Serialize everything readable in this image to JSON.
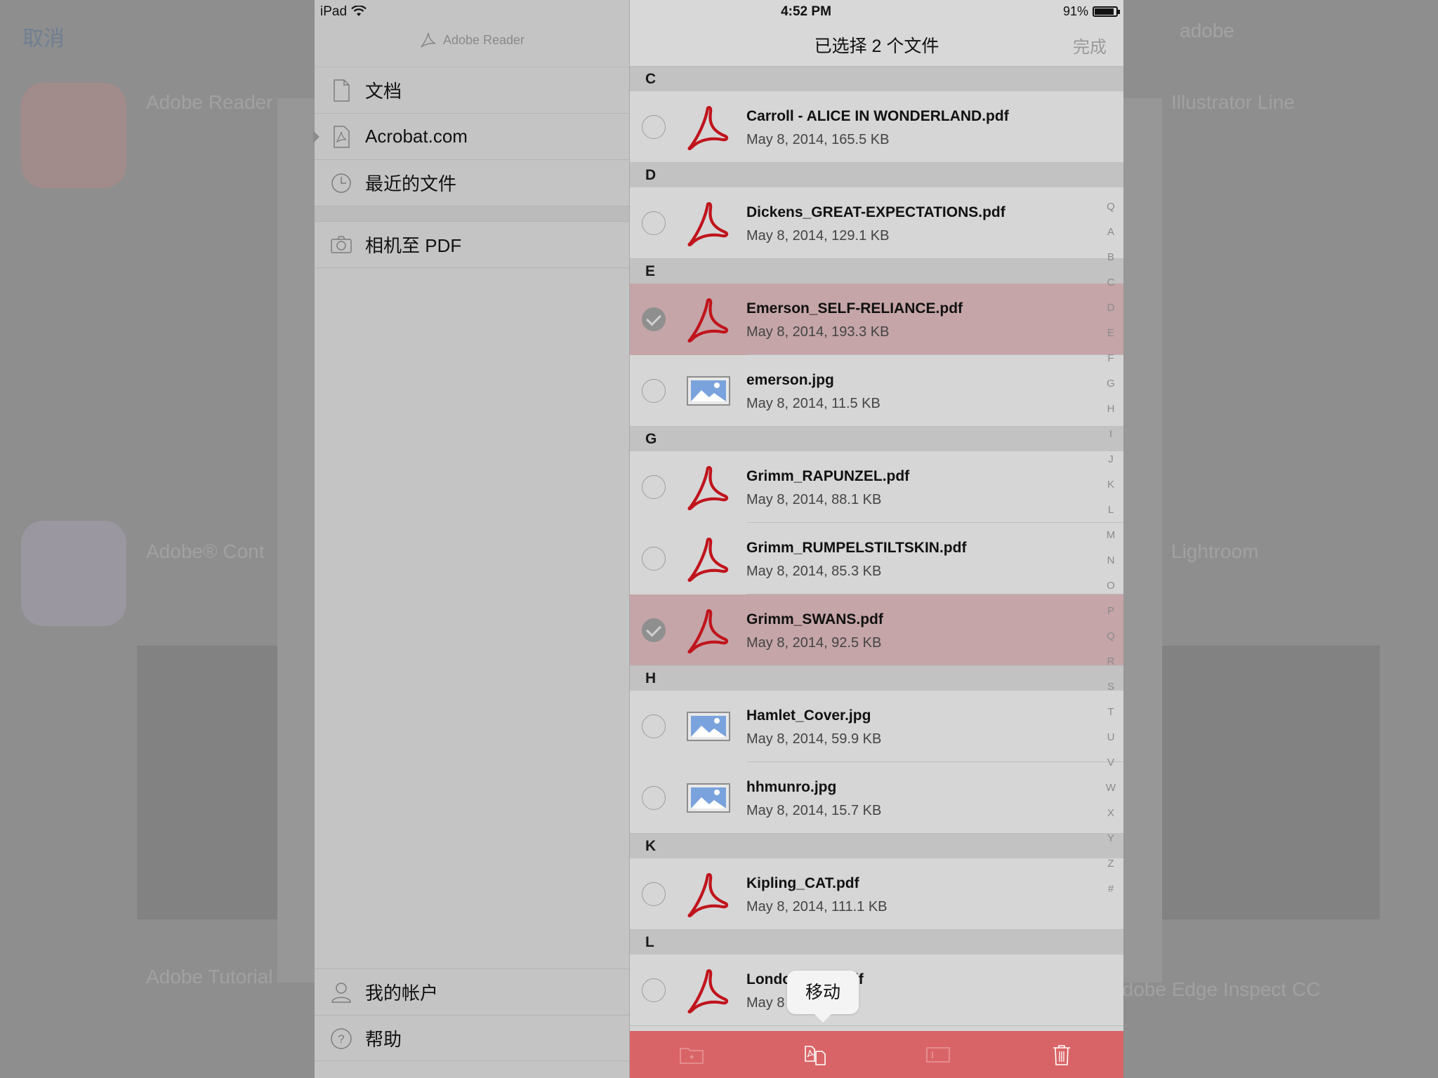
{
  "status_bar": {
    "device": "iPad",
    "time": "4:52 PM",
    "battery": "91%"
  },
  "background": {
    "cancel": "取消",
    "search": "adobe",
    "app1_title": "Adobe Reader",
    "app2_title": "Adobe® Cont",
    "app3_title": "Adobe Tutorial",
    "right_app1": "Illustrator Line",
    "right_app2": "Lightroom",
    "right_app3": "Adobe Edge Inspect CC"
  },
  "sidebar": {
    "brand": "Adobe Reader",
    "items": [
      {
        "label": "文档",
        "icon": "document-icon"
      },
      {
        "label": "Acrobat.com",
        "icon": "cloud-document-icon"
      },
      {
        "label": "最近的文件",
        "icon": "clock-icon"
      }
    ],
    "camera": {
      "label": "相机至 PDF",
      "icon": "camera-icon"
    },
    "bottom": [
      {
        "label": "我的帐户",
        "icon": "person-icon"
      },
      {
        "label": "帮助",
        "icon": "help-icon"
      }
    ]
  },
  "navbar": {
    "title": "已选择 2 个文件",
    "done": "完成"
  },
  "sections": [
    {
      "letter": "C",
      "files": [
        {
          "name": "Carroll - ALICE IN WONDERLAND.pdf",
          "meta": "May 8, 2014, 165.5 KB",
          "type": "pdf",
          "selected": false
        }
      ]
    },
    {
      "letter": "D",
      "files": [
        {
          "name": "Dickens_GREAT-EXPECTATIONS.pdf",
          "meta": "May 8, 2014, 129.1 KB",
          "type": "pdf",
          "selected": false
        }
      ]
    },
    {
      "letter": "E",
      "files": [
        {
          "name": "Emerson_SELF-RELIANCE.pdf",
          "meta": "May 8, 2014, 193.3 KB",
          "type": "pdf",
          "selected": true
        },
        {
          "name": "emerson.jpg",
          "meta": "May 8, 2014, 11.5 KB",
          "type": "image",
          "selected": false
        }
      ]
    },
    {
      "letter": "G",
      "files": [
        {
          "name": "Grimm_RAPUNZEL.pdf",
          "meta": "May 8, 2014, 88.1 KB",
          "type": "pdf",
          "selected": false
        },
        {
          "name": "Grimm_RUMPELSTILTSKIN.pdf",
          "meta": "May 8, 2014, 85.3 KB",
          "type": "pdf",
          "selected": false
        },
        {
          "name": "Grimm_SWANS.pdf",
          "meta": "May 8, 2014, 92.5 KB",
          "type": "pdf",
          "selected": true
        }
      ]
    },
    {
      "letter": "H",
      "files": [
        {
          "name": "Hamlet_Cover.jpg",
          "meta": "May 8, 2014, 59.9 KB",
          "type": "image",
          "selected": false
        },
        {
          "name": "hhmunro.jpg",
          "meta": "May 8, 2014, 15.7 KB",
          "type": "image",
          "selected": false
        }
      ]
    },
    {
      "letter": "K",
      "files": [
        {
          "name": "Kipling_CAT.pdf",
          "meta": "May 8, 2014, 111.1 KB",
          "type": "pdf",
          "selected": false
        }
      ]
    },
    {
      "letter": "L",
      "files": [
        {
          "name": "Londo    FANG.pdf",
          "meta": "May 8       .0 KB",
          "type": "pdf",
          "selected": false
        }
      ]
    }
  ],
  "index": [
    "Q",
    "A",
    "B",
    "C",
    "D",
    "E",
    "F",
    "G",
    "H",
    "I",
    "J",
    "K",
    "L",
    "M",
    "N",
    "O",
    "P",
    "Q",
    "R",
    "S",
    "T",
    "U",
    "V",
    "W",
    "X",
    "Y",
    "Z",
    "#"
  ],
  "tooltip": "移动",
  "toolbar": [
    {
      "name": "new-folder-icon"
    },
    {
      "name": "move-icon"
    },
    {
      "name": "rename-icon"
    },
    {
      "name": "trash-icon"
    }
  ],
  "colors": {
    "accent_red": "#d96467",
    "selected_row": "#c5a5a8",
    "pdf_red": "#c0141c"
  }
}
